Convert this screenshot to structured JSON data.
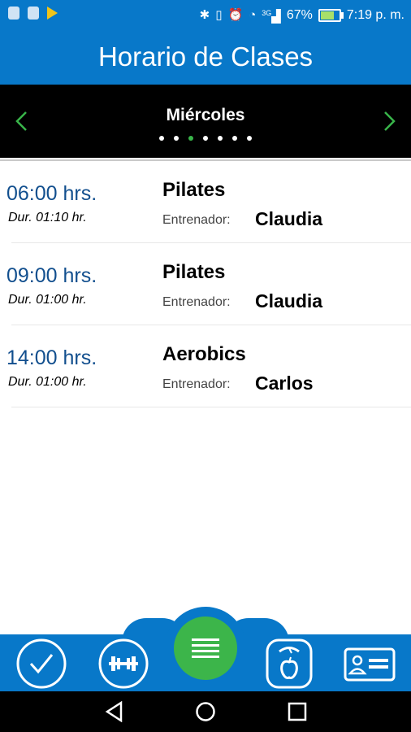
{
  "status_bar": {
    "battery_percent": "67%",
    "battery_level": 0.67,
    "time": "7:19 p. m.",
    "network": "3G"
  },
  "header": {
    "title": "Horario de Clases"
  },
  "day_selector": {
    "day": "Miércoles",
    "dots_total": 7,
    "active_dot": 3
  },
  "classes": [
    {
      "time": "06:00 hrs.",
      "duration": "Dur. 01:10 hr.",
      "name": "Pilates",
      "trainer_label": "Entrenador:",
      "trainer": "Claudia"
    },
    {
      "time": "09:00 hrs.",
      "duration": "Dur. 01:00 hr.",
      "name": "Pilates",
      "trainer_label": "Entrenador:",
      "trainer": "Claudia"
    },
    {
      "time": "14:00 hrs.",
      "duration": "Dur. 01:00 hr.",
      "name": "Aerobics",
      "trainer_label": "Entrenador:",
      "trainer": "Carlos"
    }
  ],
  "bottom_nav": {
    "items": [
      "check-icon",
      "dumbbell-icon",
      "menu-icon",
      "scale-icon",
      "id-card-icon"
    ]
  },
  "colors": {
    "primary": "#0878c9",
    "accent": "#39b54a",
    "time_text": "#124f8e"
  }
}
